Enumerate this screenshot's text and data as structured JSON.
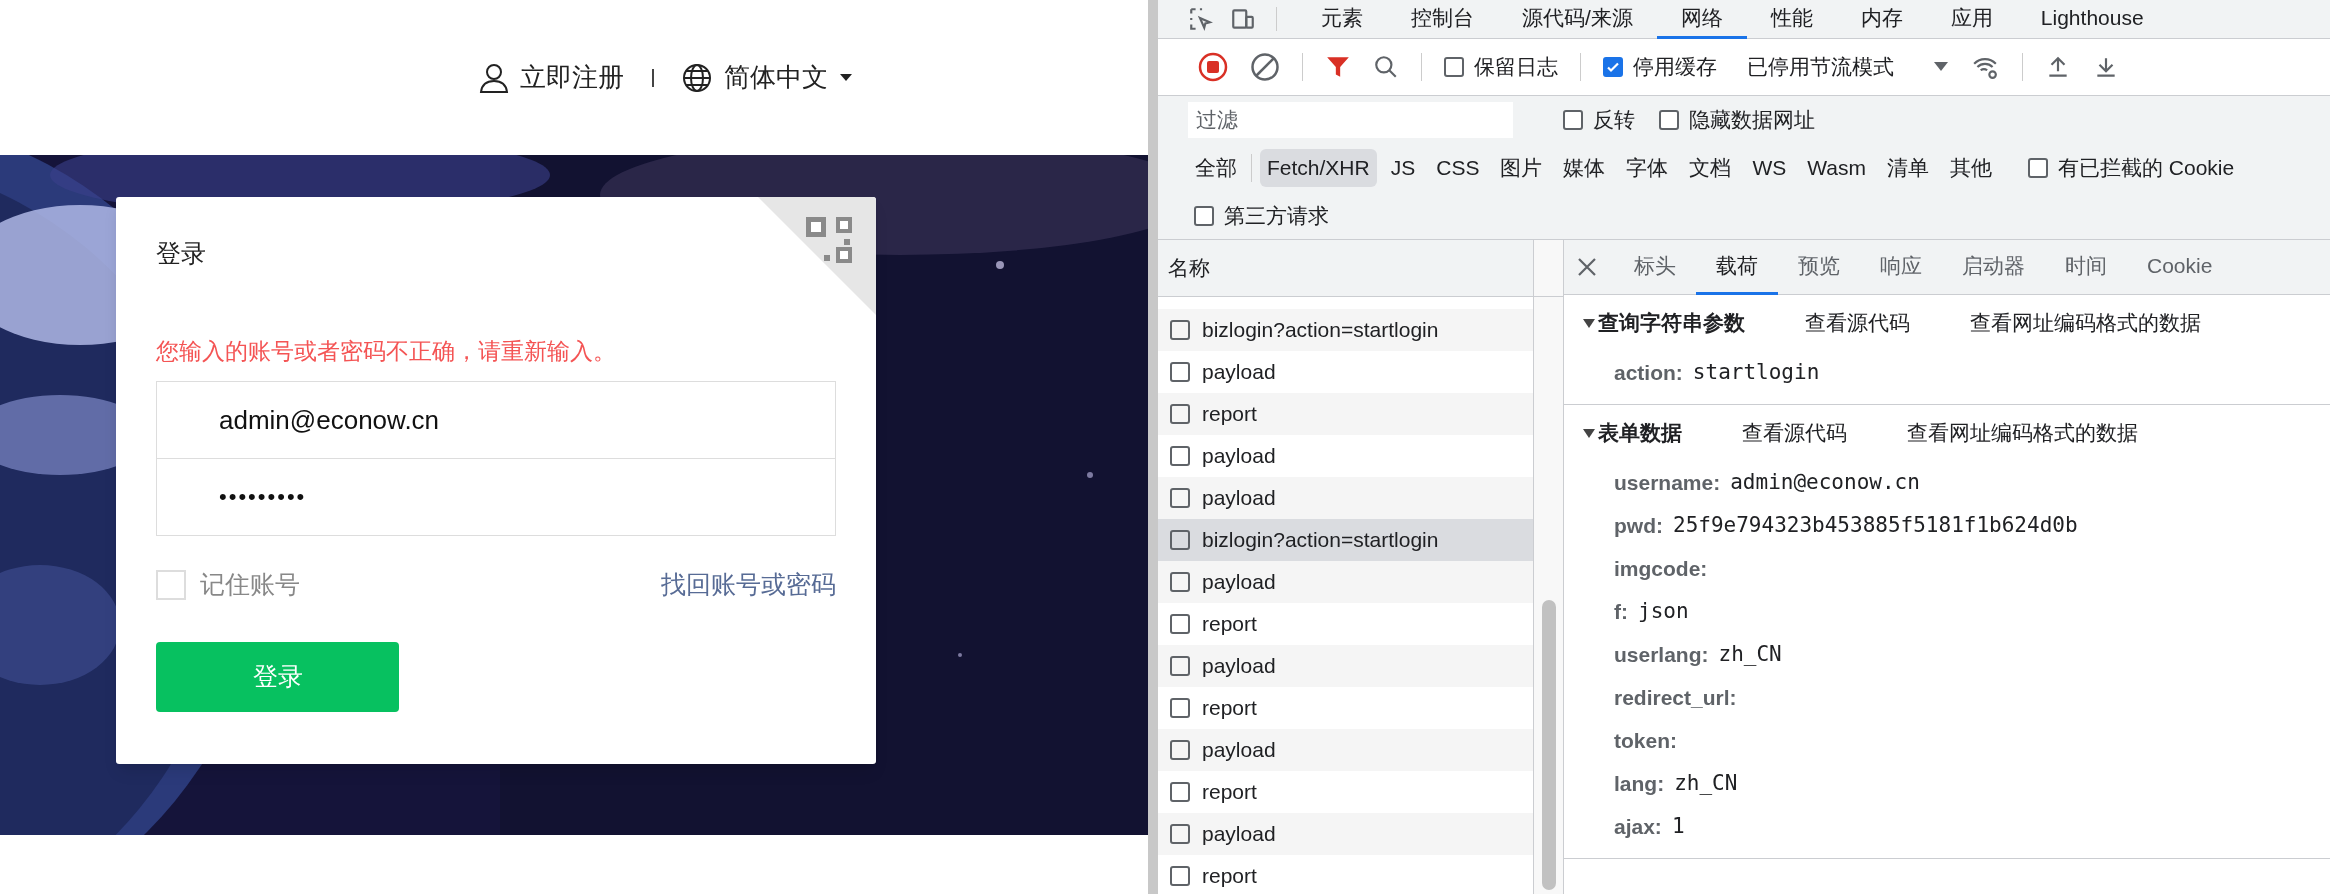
{
  "site_header": {
    "register_link": "立即注册",
    "language": "简体中文"
  },
  "login_card": {
    "title": "登录",
    "error": "您输入的账号或者密码不正确，请重新输入。",
    "username": {
      "value": "admin@econow.cn"
    },
    "password": {
      "value": "•••••••••"
    },
    "remember": {
      "label": "记住账号",
      "checked": false
    },
    "forgot_link": "找回账号或密码",
    "submit": "登录"
  },
  "devtools": {
    "tabs": [
      {
        "label": "元素",
        "selected": false
      },
      {
        "label": "控制台",
        "selected": false
      },
      {
        "label": "源代码/来源",
        "selected": false
      },
      {
        "label": "网络",
        "selected": true
      },
      {
        "label": "性能",
        "selected": false
      },
      {
        "label": "内存",
        "selected": false
      },
      {
        "label": "应用",
        "selected": false
      },
      {
        "label": "Lighthouse",
        "selected": false
      }
    ],
    "toolbar": {
      "preserve_log": {
        "label": "保留日志",
        "checked": false
      },
      "disable_cache": {
        "label": "停用缓存",
        "checked": true
      },
      "throttling": "已停用节流模式"
    },
    "filter": {
      "placeholder": "过滤",
      "invert": {
        "label": "反转",
        "checked": false
      },
      "hide_data_urls": {
        "label": "隐藏数据网址",
        "checked": false
      }
    },
    "type_filters": [
      {
        "label": "全部",
        "selected": false
      },
      {
        "label": "Fetch/XHR",
        "selected": true
      },
      {
        "label": "JS",
        "selected": false
      },
      {
        "label": "CSS",
        "selected": false
      },
      {
        "label": "图片",
        "selected": false
      },
      {
        "label": "媒体",
        "selected": false
      },
      {
        "label": "字体",
        "selected": false
      },
      {
        "label": "文档",
        "selected": false
      },
      {
        "label": "WS",
        "selected": false
      },
      {
        "label": "Wasm",
        "selected": false
      },
      {
        "label": "清单",
        "selected": false
      },
      {
        "label": "其他",
        "selected": false
      }
    ],
    "blocked_cookies": {
      "label": "有已拦截的 Cookie",
      "checked": false
    },
    "third_party": {
      "label": "第三方请求",
      "checked": false
    },
    "requests": {
      "column": "名称",
      "rows": [
        {
          "name": "bizlogin?action=startlogin",
          "selected": false
        },
        {
          "name": "payload",
          "selected": false
        },
        {
          "name": "report",
          "selected": false
        },
        {
          "name": "payload",
          "selected": false
        },
        {
          "name": "payload",
          "selected": false
        },
        {
          "name": "bizlogin?action=startlogin",
          "selected": true
        },
        {
          "name": "payload",
          "selected": false
        },
        {
          "name": "report",
          "selected": false
        },
        {
          "name": "payload",
          "selected": false
        },
        {
          "name": "report",
          "selected": false
        },
        {
          "name": "payload",
          "selected": false
        },
        {
          "name": "report",
          "selected": false
        },
        {
          "name": "payload",
          "selected": false
        },
        {
          "name": "report",
          "selected": false
        }
      ]
    },
    "detail_tabs": [
      {
        "label": "标头",
        "selected": false
      },
      {
        "label": "载荷",
        "selected": true
      },
      {
        "label": "预览",
        "selected": false
      },
      {
        "label": "响应",
        "selected": false
      },
      {
        "label": "启动器",
        "selected": false
      },
      {
        "label": "时间",
        "selected": false
      },
      {
        "label": "Cookie",
        "selected": false
      }
    ],
    "sections": [
      {
        "title": "查询字符串参数",
        "expanded": true,
        "links": [
          "查看源代码",
          "查看网址编码格式的数据"
        ],
        "params": [
          {
            "key": "action:",
            "value": "startlogin"
          }
        ]
      },
      {
        "title": "表单数据",
        "expanded": true,
        "links": [
          "查看源代码",
          "查看网址编码格式的数据"
        ],
        "params": [
          {
            "key": "username:",
            "value": "admin@econow.cn"
          },
          {
            "key": "pwd:",
            "value": "25f9e794323b453885f5181f1b624d0b"
          },
          {
            "key": "imgcode:"
          },
          {
            "key": "f:",
            "value": "json"
          },
          {
            "key": "userlang:",
            "value": "zh_CN"
          },
          {
            "key": "redirect_url:"
          },
          {
            "key": "token:"
          },
          {
            "key": "lang:",
            "value": "zh_CN"
          },
          {
            "key": "ajax:",
            "value": "1"
          }
        ]
      }
    ]
  }
}
